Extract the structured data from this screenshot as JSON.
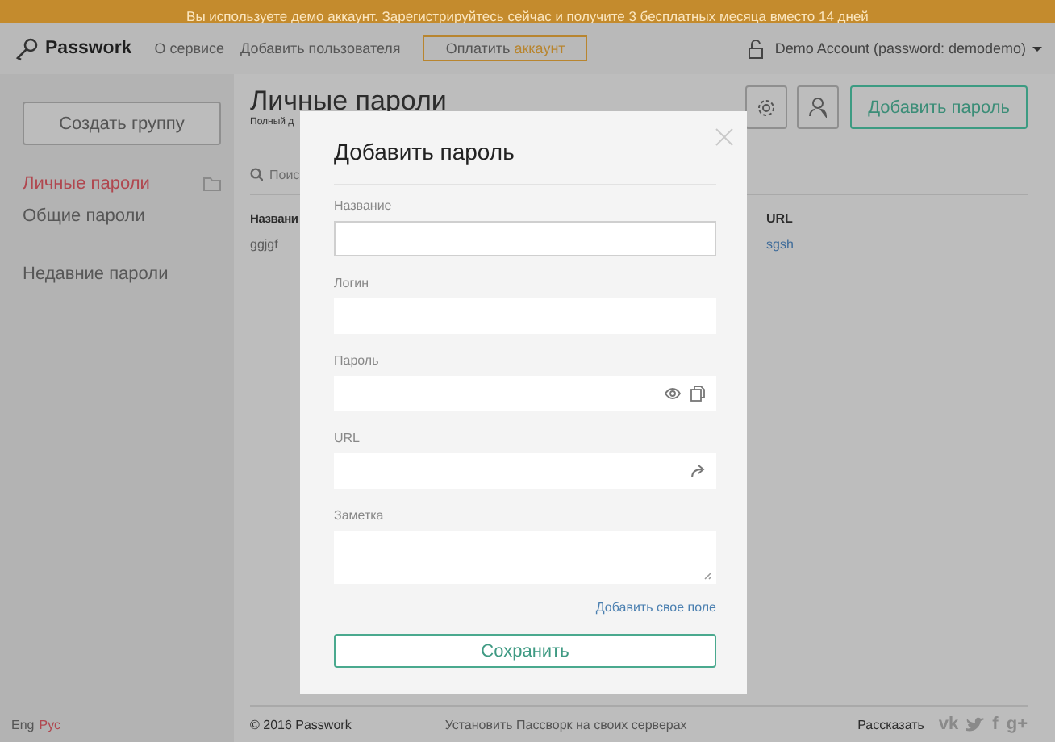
{
  "banner": {
    "text": "Вы используете демо аккаунт. Зарегистрируйтесь сейчас и получите 3 бесплатных месяца вместо 14 дней"
  },
  "header": {
    "logo": "Passwork",
    "nav": [
      {
        "label": "О сервисе"
      },
      {
        "label": "Добавить пользователя"
      }
    ],
    "pay_button": {
      "label": "Оплатить",
      "accent": "аккаунт"
    },
    "account": "Demo Account (password: demodemo)"
  },
  "sidebar": {
    "create_button": "Создать группу",
    "items": [
      {
        "label": "Личные пароли",
        "selected": true,
        "kind": "folder"
      },
      {
        "label": "Общие пароли",
        "selected": false,
        "kind": "plain"
      },
      {
        "label": "Недавние пароли",
        "selected": false,
        "kind": "recent"
      }
    ],
    "languages": [
      {
        "label": "Eng",
        "selected": false
      },
      {
        "label": "Рус",
        "selected": true
      }
    ]
  },
  "main": {
    "title": "Личные пароли",
    "subtitle": "Полный д",
    "add_button": "Добавить пароль",
    "search_placeholder": "Поис",
    "table": {
      "columns": [
        "Названи",
        "URL"
      ],
      "rows": [
        [
          "ggjgf",
          "sgsh"
        ]
      ]
    }
  },
  "modal": {
    "title": "Добавить пароль",
    "fields": [
      {
        "label": "Название",
        "kind": "text",
        "focused": true
      },
      {
        "label": "Логин",
        "kind": "text",
        "focused": false
      },
      {
        "label": "Пароль",
        "kind": "password",
        "focused": false
      },
      {
        "label": "URL",
        "kind": "url",
        "focused": false
      },
      {
        "label": "Заметка",
        "kind": "note",
        "focused": false
      }
    ],
    "add_field_link": "Добавить свое поле",
    "save_button": "Сохранить"
  },
  "footer": {
    "copyright": "© 2016 Passwork",
    "install_link": "Установить Пассворк на своих серверах",
    "share_label": "Рассказать",
    "social": [
      {
        "kind": "text",
        "label": "vk"
      },
      {
        "kind": "bird"
      },
      {
        "kind": "text",
        "label": "f"
      },
      {
        "kind": "text",
        "label": "g+"
      }
    ]
  }
}
